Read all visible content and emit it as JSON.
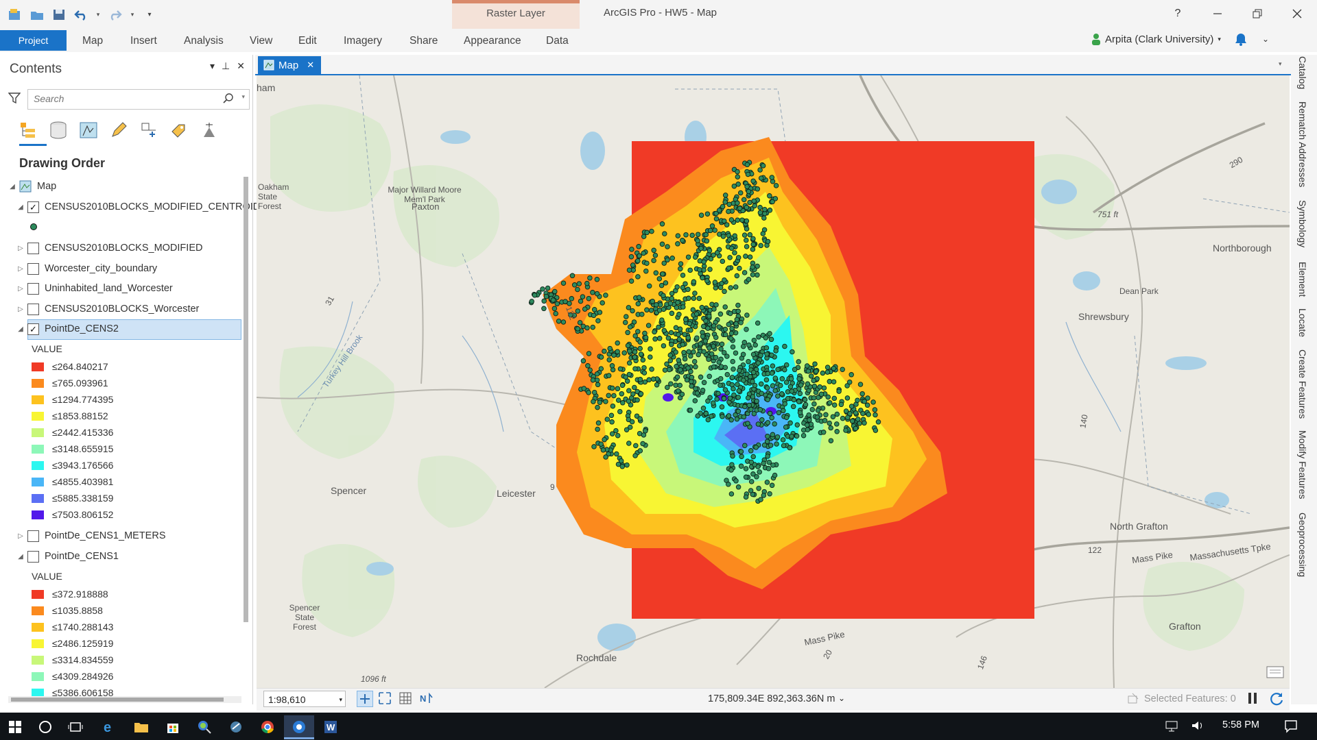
{
  "window": {
    "title": "ArcGIS Pro - HW5 - Map",
    "help": "?",
    "contextual_group": "Raster Layer"
  },
  "ribbon": {
    "tabs": [
      "Project",
      "Map",
      "Insert",
      "Analysis",
      "View",
      "Edit",
      "Imagery",
      "Share",
      "Appearance",
      "Data"
    ],
    "user": "Arpita (Clark University)"
  },
  "contents": {
    "title": "Contents",
    "search_placeholder": "Search",
    "drawing_order_title": "Drawing Order",
    "map_item": "Map",
    "layers": [
      {
        "name": "CENSUS2010BLOCKS_MODIFIED_CENTROID",
        "checked": true,
        "expanded": true
      },
      {
        "name": "CENSUS2010BLOCKS_MODIFIED",
        "checked": false,
        "expanded": false
      },
      {
        "name": "Worcester_city_boundary",
        "checked": false,
        "expanded": false
      },
      {
        "name": "Uninhabited_land_Worcester",
        "checked": false,
        "expanded": false
      },
      {
        "name": "CENSUS2010BLOCKS_Worcester",
        "checked": false,
        "expanded": false
      },
      {
        "name": "PointDe_CENS2",
        "checked": true,
        "expanded": true,
        "selected": true
      },
      {
        "name": "PointDe_CENS1_METERS",
        "checked": false,
        "expanded": false
      },
      {
        "name": "PointDe_CENS1",
        "checked": false,
        "expanded": true
      }
    ],
    "legend_heading": "VALUE",
    "legend_cens2": [
      {
        "label": "≤264.840217",
        "color": "#f03a26"
      },
      {
        "label": "≤765.093961",
        "color": "#fb8a1e"
      },
      {
        "label": "≤1294.774395",
        "color": "#fdc21f"
      },
      {
        "label": "≤1853.88152",
        "color": "#f8f533"
      },
      {
        "label": "≤2442.415336",
        "color": "#c8f779"
      },
      {
        "label": "≤3148.655915",
        "color": "#8df7b8"
      },
      {
        "label": "≤3943.176566",
        "color": "#2cf7f0"
      },
      {
        "label": "≤4855.403981",
        "color": "#4ab6f7"
      },
      {
        "label": "≤5885.338159",
        "color": "#5b6ff4"
      },
      {
        "label": "≤7503.806152",
        "color": "#5218ea"
      }
    ],
    "legend_cens1": [
      {
        "label": "≤372.918888",
        "color": "#f03a26"
      },
      {
        "label": "≤1035.8858",
        "color": "#fb8a1e"
      },
      {
        "label": "≤1740.288143",
        "color": "#fdc21f"
      },
      {
        "label": "≤2486.125919",
        "color": "#f8f533"
      },
      {
        "label": "≤3314.834559",
        "color": "#c8f779"
      },
      {
        "label": "≤4309.284926",
        "color": "#8df7b8"
      },
      {
        "label": "≤5386.606158",
        "color": "#2cf7f0"
      }
    ]
  },
  "map_view": {
    "tab_label": "Map",
    "places": [
      "Paxton",
      "Oakham State Forest",
      "Major Willard Moore Mem'l Park",
      "Turkey Hill Brook",
      "Spencer",
      "Leicester",
      "Spencer State Forest",
      "Rochdale",
      "Shrewsbury",
      "Northborough",
      "Dean Park",
      "North Grafton",
      "Grafton",
      "Mass Pike",
      "Massachusetts Tpke"
    ],
    "road_labels": [
      "751 ft",
      "1096 ft",
      "290",
      "140",
      "146",
      "122",
      "20",
      "9",
      "31"
    ],
    "side_panes": [
      "Catalog",
      "Rematch Addresses",
      "Symbology",
      "Element",
      "Locate",
      "Create Features",
      "Modify Features",
      "Geoprocessing"
    ]
  },
  "status": {
    "scale": "1:98,610",
    "coordinates": "175,809.34E 892,363.36N m",
    "selected_features": "Selected Features: 0"
  },
  "taskbar": {
    "time": "5:58 PM"
  }
}
